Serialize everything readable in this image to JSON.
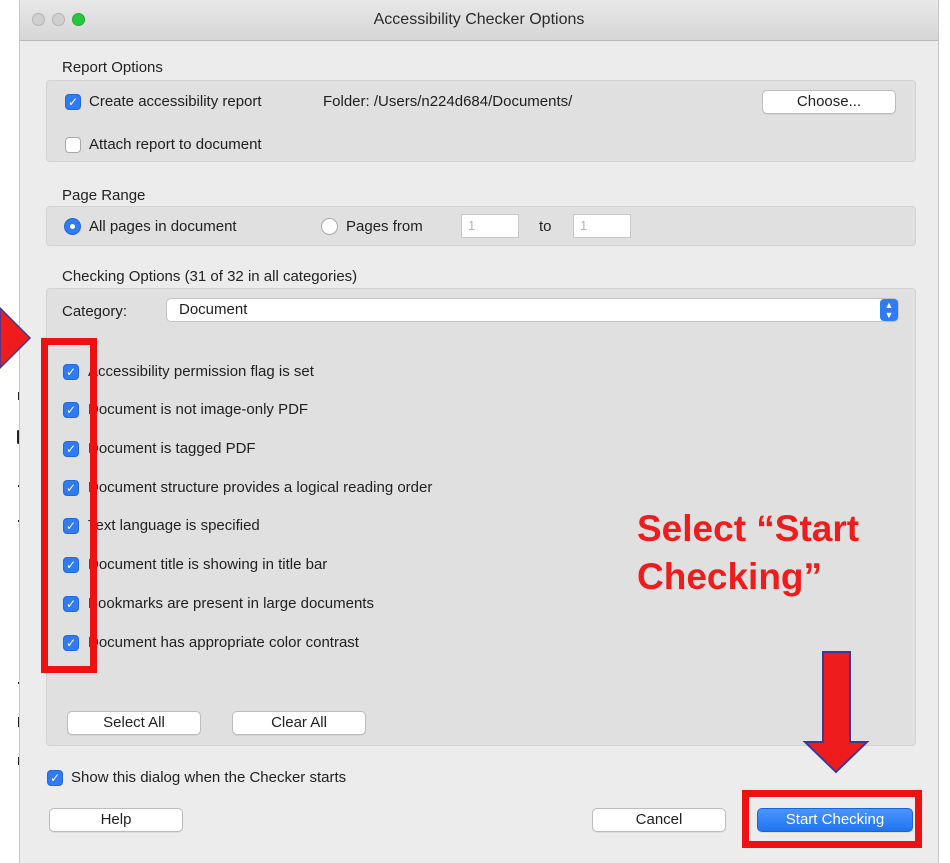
{
  "window": {
    "title": "Accessibility Checker Options"
  },
  "report_options": {
    "label": "Report Options",
    "create_report": {
      "label": "Create accessibility report",
      "checked": true
    },
    "folder_text": "Folder: /Users/n224d684/Documents/",
    "choose_label": "Choose...",
    "attach_report": {
      "label": "Attach report to document",
      "checked": false
    }
  },
  "page_range": {
    "label": "Page Range",
    "all_pages_label": "All pages in document",
    "pages_from_label": "Pages from",
    "from_value": "1",
    "to_label": "to",
    "to_value": "1",
    "selected": "all"
  },
  "checking_options": {
    "label": "Checking Options (31 of 32 in all categories)",
    "category_label": "Category:",
    "category_value": "Document",
    "items": [
      {
        "label": "Accessibility permission flag is set",
        "checked": true
      },
      {
        "label": "Document is not image-only PDF",
        "checked": true
      },
      {
        "label": "Document is tagged PDF",
        "checked": true
      },
      {
        "label": "Document structure provides a logical reading order",
        "checked": true
      },
      {
        "label": "Text language is specified",
        "checked": true
      },
      {
        "label": "Document title is showing in title bar",
        "checked": true
      },
      {
        "label": "Bookmarks are present in large documents",
        "checked": true
      },
      {
        "label": "Document has appropriate color contrast",
        "checked": true
      }
    ],
    "select_all_label": "Select All",
    "clear_all_label": "Clear All"
  },
  "footer": {
    "show_dialog": {
      "label": "Show this dialog when the Checker starts",
      "checked": true
    },
    "help_label": "Help",
    "cancel_label": "Cancel",
    "start_label": "Start Checking"
  },
  "annotation": {
    "line1": "Select “Start",
    "line2": "Checking”",
    "color": "#ee1c1c"
  },
  "colors": {
    "accent": "#2f7bf5",
    "window_bg": "#ececec",
    "annotation_red": "#ee1111"
  }
}
